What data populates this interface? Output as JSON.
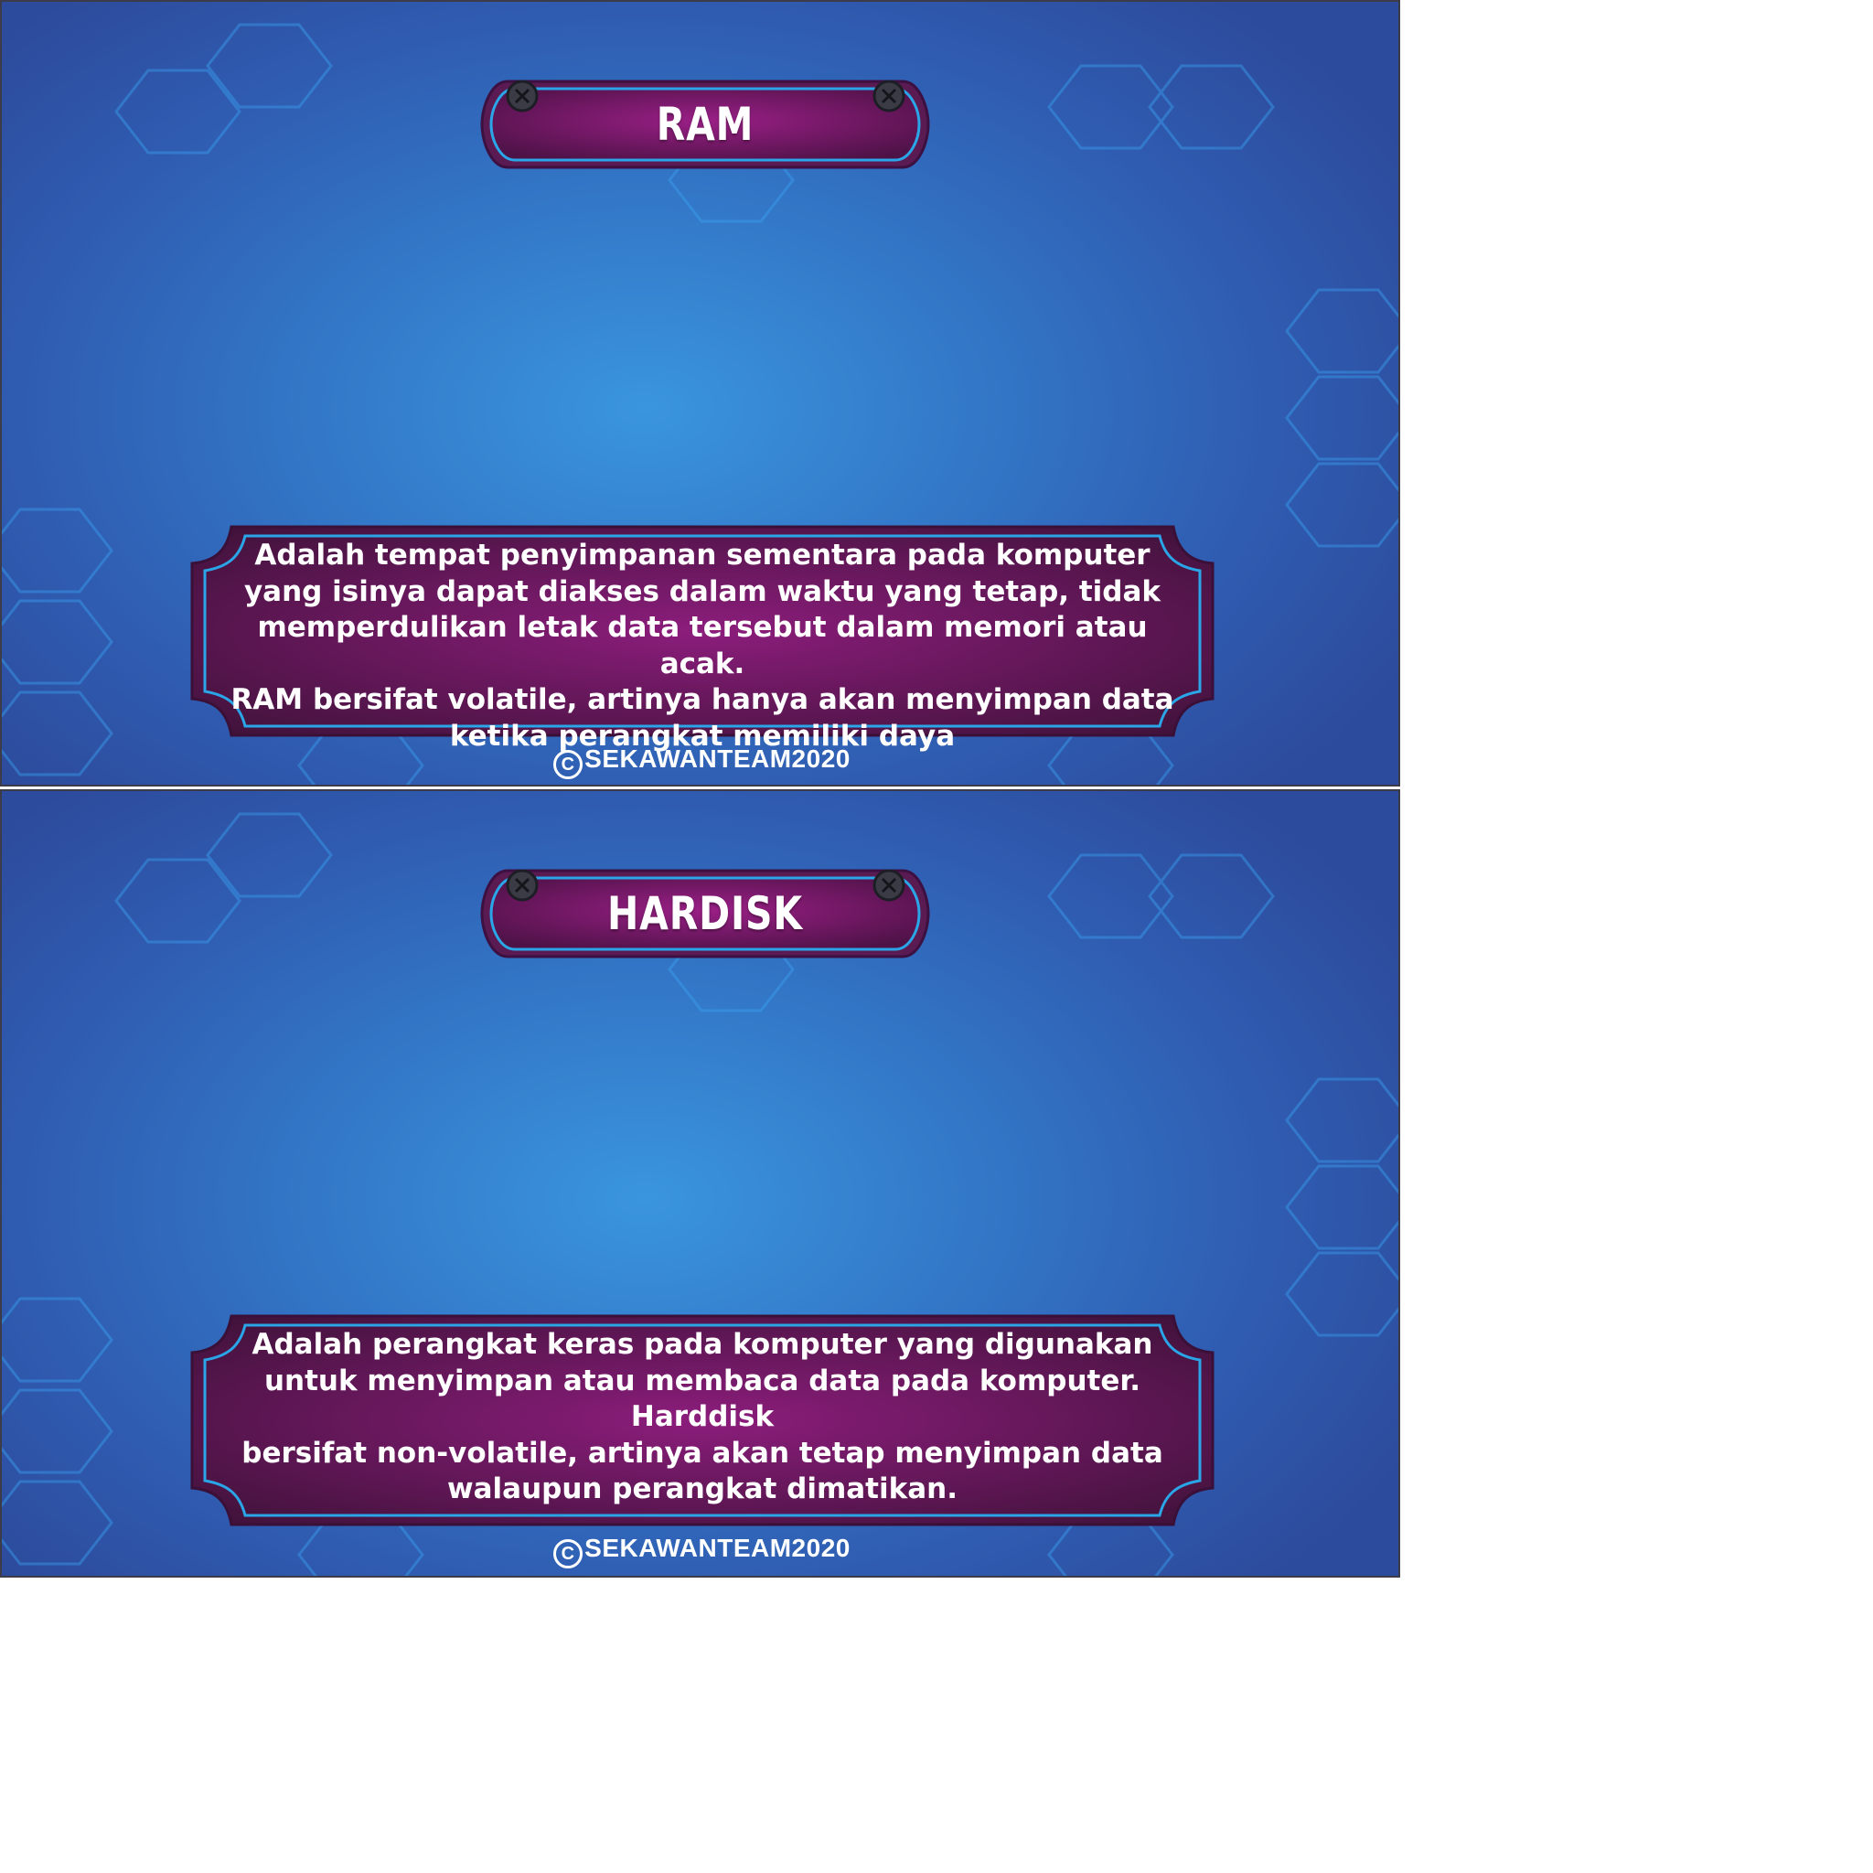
{
  "slides": [
    {
      "title": "RAM",
      "body": "Adalah tempat penyimpanan sementara pada komputer\nyang isinya dapat diakses dalam waktu yang tetap, tidak\nmemperdulikan letak data tersebut dalam memori atau acak.\nRAM bersifat volatile, artinya hanya akan menyimpan data\nketika perangkat memiliki daya",
      "copyright": "SEKAWANTEAM2020"
    },
    {
      "title": "HARDISK",
      "body": "Adalah perangkat keras pada komputer yang digunakan\nuntuk menyimpan atau membaca data pada komputer. Harddisk\nbersifat non-volatile, artinya akan tetap menyimpan data\nwalaupun perangkat dimatikan.",
      "copyright": "SEKAWANTEAM2020"
    }
  ],
  "colors": {
    "background_center": "#3a95de",
    "background_edge": "#2d4b9c",
    "panel_fill": "#6a1a5e",
    "panel_border": "#2aa6e8",
    "text": "#ffffff"
  },
  "icons": {
    "copyright": "copyright-icon",
    "screw": "screw-icon"
  }
}
